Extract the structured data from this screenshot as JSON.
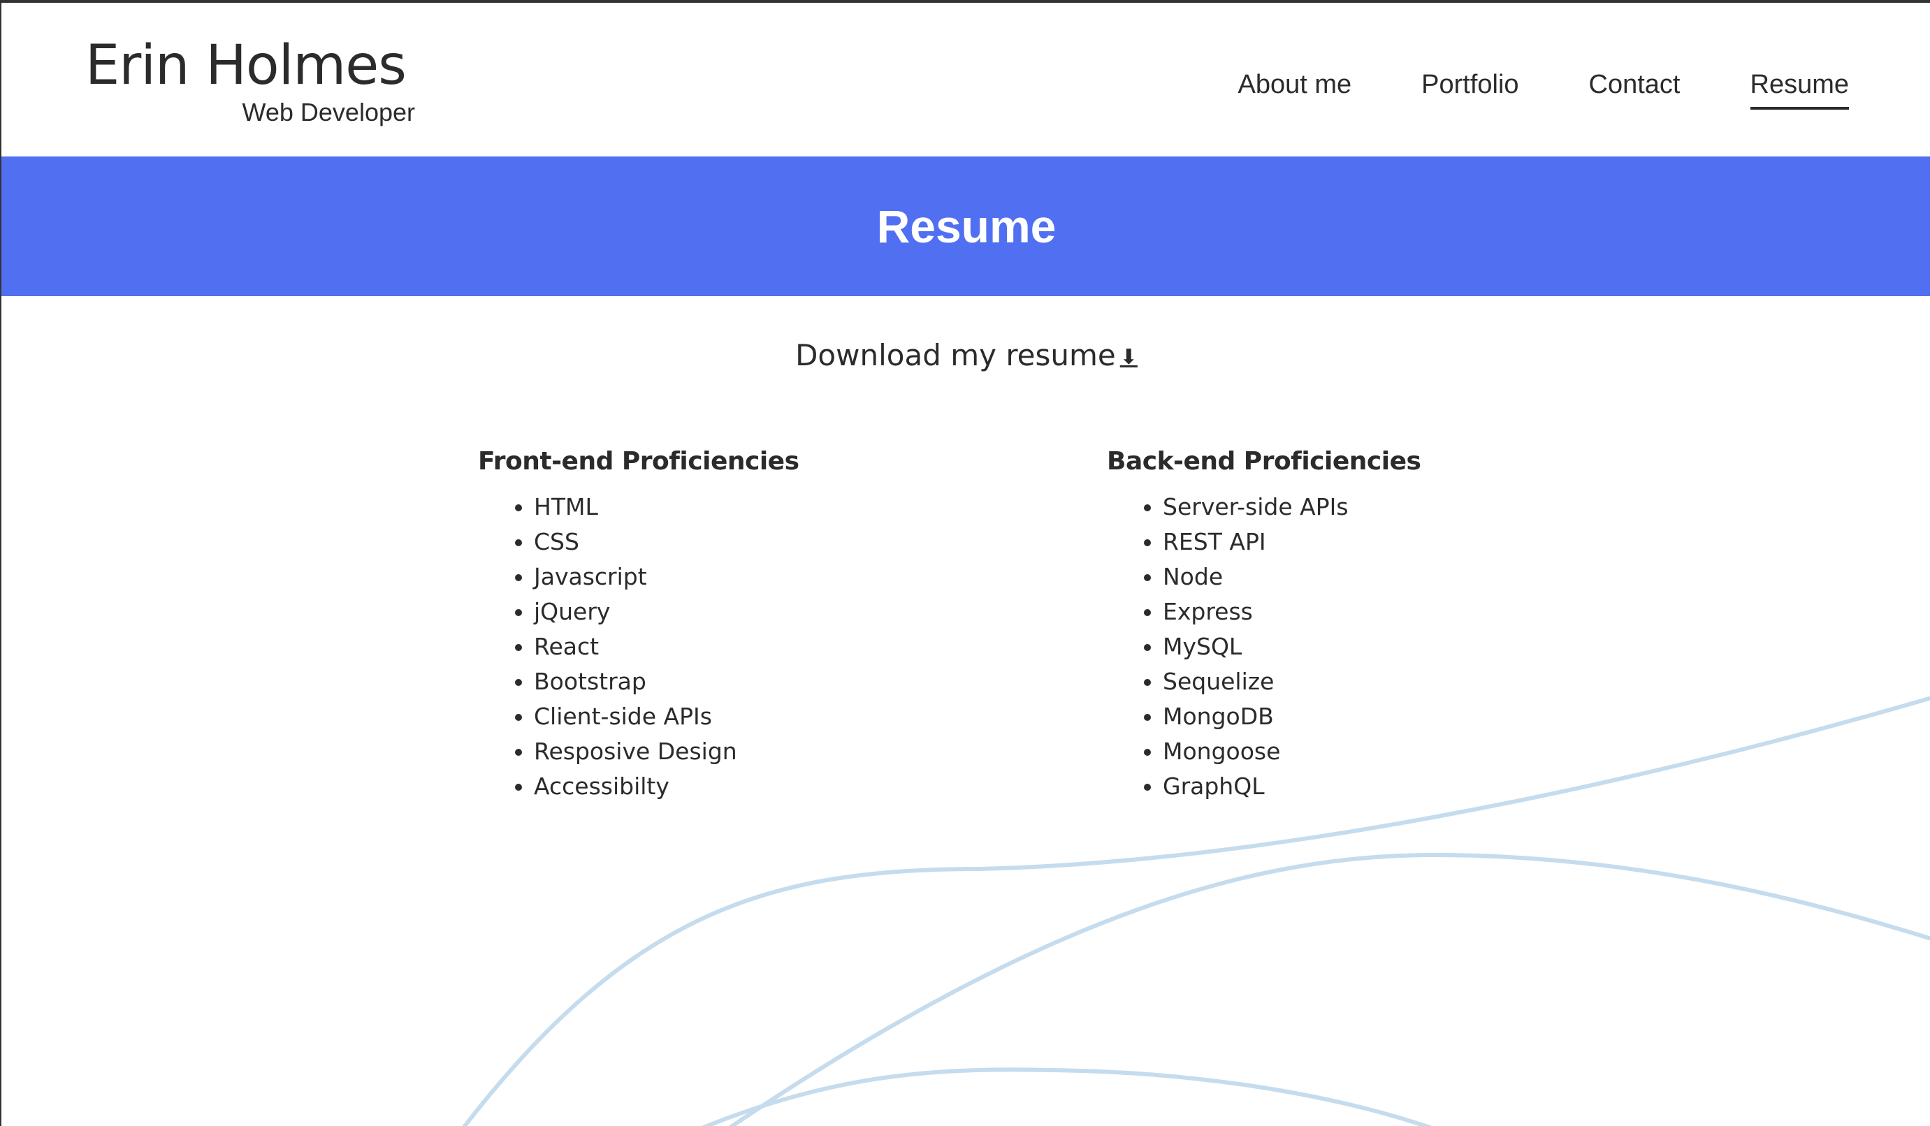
{
  "header": {
    "name": "Erin Holmes",
    "role": "Web Developer",
    "nav": [
      {
        "label": "About me"
      },
      {
        "label": "Portfolio"
      },
      {
        "label": "Contact"
      },
      {
        "label": "Resume",
        "active": true
      }
    ]
  },
  "banner": {
    "title": "Resume",
    "color": "#5170f1"
  },
  "download": {
    "label": "Download my resume",
    "icon": "download-icon",
    "icon_glyph": "⬇"
  },
  "frontend": {
    "heading": "Front-end Proficiencies",
    "items": [
      "HTML",
      "CSS",
      "Javascript",
      "jQuery",
      "React",
      "Bootstrap",
      "Client-side APIs",
      "Resposive Design",
      "Accessibilty"
    ]
  },
  "backend": {
    "heading": "Back-end Proficiencies",
    "items": [
      "Server-side APIs",
      "REST API",
      "Node",
      "Express",
      "MySQL",
      "Sequelize",
      "MongoDB",
      "Mongoose",
      "GraphQL"
    ]
  },
  "decoration": {
    "curve_color": "#c5dcee"
  }
}
